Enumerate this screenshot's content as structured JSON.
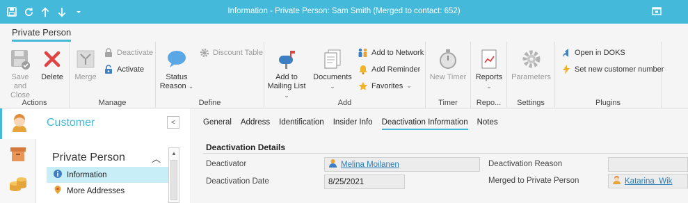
{
  "window": {
    "title": "Information - Private Person: Sam Smith (Merged to contact: 652)",
    "quick_access": [
      "save-icon",
      "refresh-icon",
      "arrow-up-icon",
      "arrow-down-icon",
      "dropdown-icon"
    ]
  },
  "ribbon": {
    "tab": "Private Person",
    "groups": {
      "actions": {
        "label": "Actions",
        "save_close": "Save and Close",
        "save_close_line1": "Save and",
        "save_close_line2": "Close",
        "delete": "Delete"
      },
      "manage": {
        "label": "Manage",
        "merge": "Merge",
        "deactivate": "Deactivate",
        "activate": "Activate"
      },
      "define": {
        "label": "Define",
        "status_reason_line1": "Status",
        "status_reason_line2": "Reason",
        "discount_table": "Discount Table"
      },
      "add": {
        "label": "Add",
        "add_mailing_line1": "Add to",
        "add_mailing_line2": "Mailing List",
        "documents": "Documents",
        "add_to_network": "Add to Network",
        "add_reminder": "Add Reminder",
        "favorites": "Favorites"
      },
      "timer": {
        "label": "Timer",
        "new_timer": "New Timer"
      },
      "reports": {
        "label": "Repo...",
        "reports": "Reports"
      },
      "settings": {
        "label": "Settings",
        "parameters": "Parameters"
      },
      "plugins": {
        "label": "Plugins",
        "open_in_doks": "Open in DOKS",
        "set_new_customer_number": "Set new customer number"
      }
    }
  },
  "navigation": {
    "title": "Customer",
    "section": "Private Person",
    "items": [
      {
        "label": "Information",
        "icon": "info-icon",
        "active": true
      },
      {
        "label": "More Addresses",
        "icon": "address-icon",
        "active": false
      }
    ]
  },
  "content": {
    "tabs": [
      {
        "label": "General",
        "active": false
      },
      {
        "label": "Address",
        "active": false
      },
      {
        "label": "Identification",
        "active": false
      },
      {
        "label": "Insider Info",
        "active": false
      },
      {
        "label": "Deactivation Information",
        "active": true
      },
      {
        "label": "Notes",
        "active": false
      }
    ],
    "section_title": "Deactivation Details",
    "fields": {
      "deactivator": {
        "label": "Deactivator",
        "value": "Melina Moilanen"
      },
      "deactivation_date": {
        "label": "Deactivation Date",
        "value": "8/25/2021"
      },
      "deactivation_reason": {
        "label": "Deactivation Reason",
        "value": ""
      },
      "merged_to": {
        "label": "Merged to Private Person",
        "value": "Katarina  Wik"
      }
    }
  },
  "colors": {
    "accent": "#45b9d9",
    "selected_nav": "#c8eef8",
    "link": "#2a7fb8",
    "delete_red": "#e04343"
  }
}
